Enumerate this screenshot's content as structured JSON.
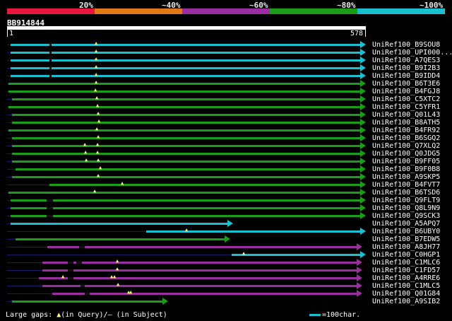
{
  "legend": {
    "labels": [
      "20%",
      "~40%",
      "~60%",
      "~80%",
      "~100%"
    ],
    "colors": [
      "#e8163c",
      "#e07818",
      "#9a2ea0",
      "#1a9e1a",
      "#19c0d0"
    ]
  },
  "query": {
    "id": "BB914844",
    "start": "1",
    "end": "578"
  },
  "hits": [
    {
      "name": "UniRef100_B9SOU8",
      "color": "#19c0d0"
    },
    {
      "name": "UniRef100_UPI000...",
      "color": "#19c0d0"
    },
    {
      "name": "UniRef100_A7QES3",
      "color": "#19c0d0"
    },
    {
      "name": "UniRef100_B9I2B3",
      "color": "#19c0d0"
    },
    {
      "name": "UniRef100_B9IDD4",
      "color": "#19c0d0"
    },
    {
      "name": "UniRef100_B6T3E6",
      "color": "#1a9e1a"
    },
    {
      "name": "UniRef100_B4FGJ8",
      "color": "#1a9e1a"
    },
    {
      "name": "UniRef100_C5XTC2",
      "color": "#1a9e1a"
    },
    {
      "name": "UniRef100_C5YFR1",
      "color": "#1a9e1a"
    },
    {
      "name": "UniRef100_Q01L43",
      "color": "#1a9e1a"
    },
    {
      "name": "UniRef100_B8ATH5",
      "color": "#1a9e1a"
    },
    {
      "name": "UniRef100_B4FR92",
      "color": "#1a9e1a"
    },
    {
      "name": "UniRef100_B6SGQ2",
      "color": "#1a9e1a"
    },
    {
      "name": "UniRef100_Q7XLQ2",
      "color": "#1a9e1a"
    },
    {
      "name": "UniRef100_Q0JDG5",
      "color": "#1a9e1a"
    },
    {
      "name": "UniRef100_B9FF05",
      "color": "#1a9e1a"
    },
    {
      "name": "UniRef100_B9F0B8",
      "color": "#1a9e1a"
    },
    {
      "name": "UniRef100_A9SKP5",
      "color": "#1a9e1a"
    },
    {
      "name": "UniRef100_B4FVT7",
      "color": "#1a9e1a"
    },
    {
      "name": "UniRef100_B6TSD6",
      "color": "#1a9e1a"
    },
    {
      "name": "UniRef100_Q9FLT9",
      "color": "#1a9e1a"
    },
    {
      "name": "UniRef100_Q8L9N9",
      "color": "#1a9e1a"
    },
    {
      "name": "UniRef100_Q9SCK3",
      "color": "#1a9e1a"
    },
    {
      "name": "UniRef100_A5APQ7",
      "color": "#19c0d0"
    },
    {
      "name": "UniRef100_B6UBY0",
      "color": "#19c0d0"
    },
    {
      "name": "UniRef100_B7EDW5",
      "color": "#1a9e1a"
    },
    {
      "name": "UniRef100_A8JH77",
      "color": "#9a2ea0"
    },
    {
      "name": "UniRef100_C0HGP1",
      "color": "#19c0d0"
    },
    {
      "name": "UniRef100_C1MLC6",
      "color": "#9a2ea0"
    },
    {
      "name": "UniRef100_C1FD57",
      "color": "#9a2ea0"
    },
    {
      "name": "UniRef100_A4RRE6",
      "color": "#9a2ea0"
    },
    {
      "name": "UniRef100_C1MLC5",
      "color": "#9a2ea0"
    },
    {
      "name": "UniRef100_Q01G84",
      "color": "#9a2ea0"
    },
    {
      "name": "UniRef100_A9SIB2",
      "color": "#1a9e1a"
    }
  ],
  "footer": {
    "gap_label": "Large gaps:",
    "query_marker": "▲",
    "query_text": "(in Query)/",
    "subject_marker": "–",
    "subject_text": " (in Subject)",
    "scale_text": "=100char."
  }
}
